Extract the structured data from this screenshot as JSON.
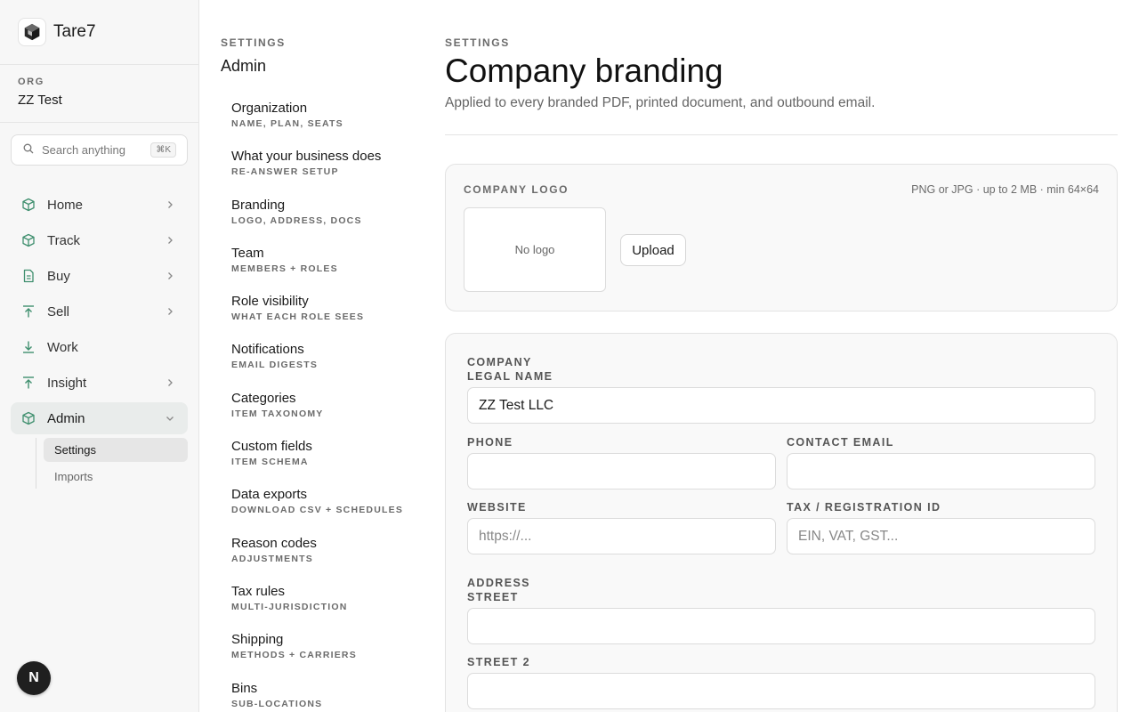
{
  "app": {
    "name": "Tare7"
  },
  "org": {
    "label": "ORG",
    "name": "ZZ Test"
  },
  "search": {
    "placeholder": "Search anything",
    "shortcut": "⌘K"
  },
  "nav": {
    "items": [
      {
        "label": "Home",
        "icon": "cube-icon"
      },
      {
        "label": "Track",
        "icon": "cube-icon"
      },
      {
        "label": "Buy",
        "icon": "document-icon"
      },
      {
        "label": "Sell",
        "icon": "upload-icon"
      },
      {
        "label": "Work",
        "icon": "download-icon"
      },
      {
        "label": "Insight",
        "icon": "upload-icon"
      },
      {
        "label": "Admin",
        "icon": "cube-icon"
      }
    ],
    "admin_sub": [
      {
        "label": "Settings"
      },
      {
        "label": "Imports"
      }
    ]
  },
  "user": {
    "initial": "N"
  },
  "settings": {
    "eyebrow": "SETTINGS",
    "title": "Admin",
    "items": [
      {
        "title": "Organization",
        "sub": "NAME, PLAN, SEATS"
      },
      {
        "title": "What your business does",
        "sub": "RE-ANSWER SETUP"
      },
      {
        "title": "Branding",
        "sub": "LOGO, ADDRESS, DOCS"
      },
      {
        "title": "Team",
        "sub": "MEMBERS + ROLES"
      },
      {
        "title": "Role visibility",
        "sub": "WHAT EACH ROLE SEES"
      },
      {
        "title": "Notifications",
        "sub": "EMAIL DIGESTS"
      },
      {
        "title": "Categories",
        "sub": "ITEM TAXONOMY"
      },
      {
        "title": "Custom fields",
        "sub": "ITEM SCHEMA"
      },
      {
        "title": "Data exports",
        "sub": "DOWNLOAD CSV + SCHEDULES"
      },
      {
        "title": "Reason codes",
        "sub": "ADJUSTMENTS"
      },
      {
        "title": "Tax rules",
        "sub": "MULTI-JURISDICTION"
      },
      {
        "title": "Shipping",
        "sub": "METHODS + CARRIERS"
      },
      {
        "title": "Bins",
        "sub": "SUB-LOCATIONS"
      }
    ]
  },
  "main": {
    "eyebrow": "SETTINGS",
    "title": "Company branding",
    "description": "Applied to every branded PDF, printed document, and outbound email.",
    "logo": {
      "label": "COMPANY LOGO",
      "hint": "PNG or JPG · up to 2 MB · min 64×64",
      "empty": "No logo",
      "upload_label": "Upload"
    },
    "form": {
      "company_section": "COMPANY",
      "legal_name_label": "LEGAL NAME",
      "legal_name_value": "ZZ Test LLC",
      "phone_label": "PHONE",
      "phone_value": "",
      "email_label": "CONTACT EMAIL",
      "email_value": "",
      "website_label": "WEBSITE",
      "website_placeholder": "https://...",
      "tax_label": "TAX / REGISTRATION ID",
      "tax_placeholder": "EIN, VAT, GST...",
      "address_section": "ADDRESS",
      "street_label": "STREET",
      "street_value": "",
      "street2_label": "STREET 2",
      "street2_value": ""
    }
  },
  "colors": {
    "accent": "#3f8f6e",
    "sidebar_bg": "#f7f7f7",
    "active_bg": "#e9eceb"
  }
}
